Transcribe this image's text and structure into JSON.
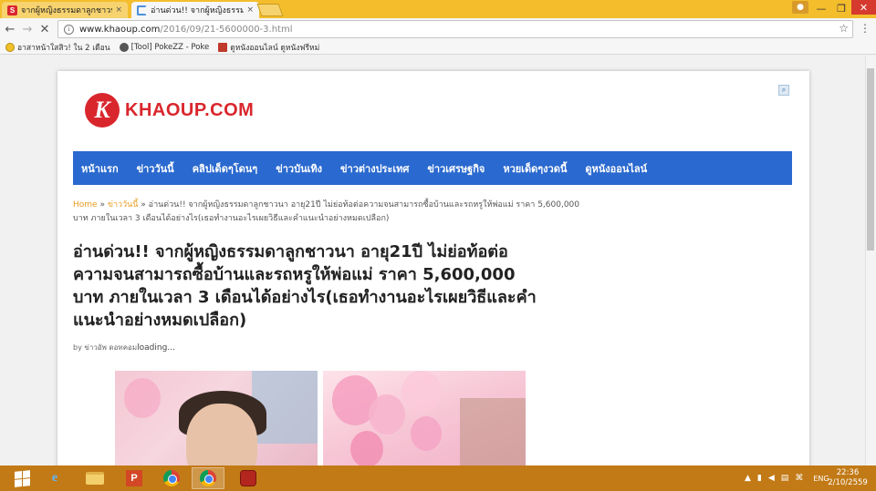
{
  "browser": {
    "tabs": [
      {
        "title": "จากผู้หญิงธรรมดาลูกชาวนา",
        "favicon": "s-logo-icon",
        "active": false
      },
      {
        "title": "อ่านด่วน!! จากผู้หญิงธรรมดา",
        "favicon": "loading-spinner-icon",
        "active": true
      }
    ],
    "close_tab": "×",
    "window_controls": {
      "user": "●",
      "minimize": "—",
      "maximize": "❐",
      "close": "✕"
    },
    "nav": {
      "back": "←",
      "forward": "→",
      "stop": "✕"
    },
    "url_domain": "www.khaoup.com",
    "url_path": "/2016/09/21-5600000-3.html",
    "info_icon": "i",
    "star": "☆",
    "menu": "⋮",
    "bookmarks": [
      {
        "label": "อาสาหน้าใสสิว! ใน 2 เดือน",
        "icon": "smiley-icon"
      },
      {
        "label": "[Tool] PokeZZ - Poke",
        "icon": "pokeball-icon"
      },
      {
        "label": "ดูหนังออนไลน์ ดูหนังฟรีหม่",
        "icon": "movie-icon"
      }
    ]
  },
  "site": {
    "logo_mark": "K",
    "logo_text": "KHAOUP.COM",
    "search_icon": "🔍",
    "nav": [
      "หน้าแรก",
      "ข่าววันนี้",
      "คลิปเด็ดๆโดนๆ",
      "ข่าวบันเทิง",
      "ข่าวต่างประเทศ",
      "ข่าวเศรษฐกิจ",
      "หวยเด็ดๆงวดนี้",
      "ดูหนังออนไลน์"
    ],
    "breadcrumb": {
      "home": "Home",
      "sep1": " » ",
      "category": "ข่าววันนี้",
      "sep2": " » ",
      "current": "อ่านด่วน!! จากผู้หญิงธรรมดาลูกชาวนา อายุ21ปี ไม่ย่อท้อต่อความจนสามารถซื้อบ้านและรถหรูให้พ่อแม่ ราคา 5,600,000 บาท ภายในเวลา 3 เดือนได้อย่างไร(เธอทำงานอะไรเผยวิธีและคำแนะนำอย่างหมดเปลือก)"
    },
    "title": "อ่านด่วน!! จากผู้หญิงธรรมดาลูกชาวนา อายุ21ปี ไม่ย่อท้อต่อความจนสามารถซื้อบ้านและรถหรูให้พ่อแม่ ราคา 5,600,000 บาท ภายในเวลา 3 เดือนได้อย่างไร(เธอทำงานอะไรเผยวิธีและคำแนะนำอย่างหมดเปลือก)",
    "byline_prefix": "by ข่าวอัพ ดอทคอม",
    "byline_loading": "loading..."
  },
  "taskbar": {
    "ie_label": "e",
    "ppt_label": "P",
    "tray_icons": [
      "▲",
      "▮",
      "◀",
      "▤",
      "⌘"
    ],
    "language": "ENG",
    "time": "22:36",
    "date": "2/10/2559"
  },
  "colors": {
    "titlebar": "#f4bd2c",
    "nav_blue": "#2a69cf",
    "logo_red": "#d9262d",
    "breadcrumb_link": "#e99b1d",
    "taskbar": "#c27a16"
  }
}
